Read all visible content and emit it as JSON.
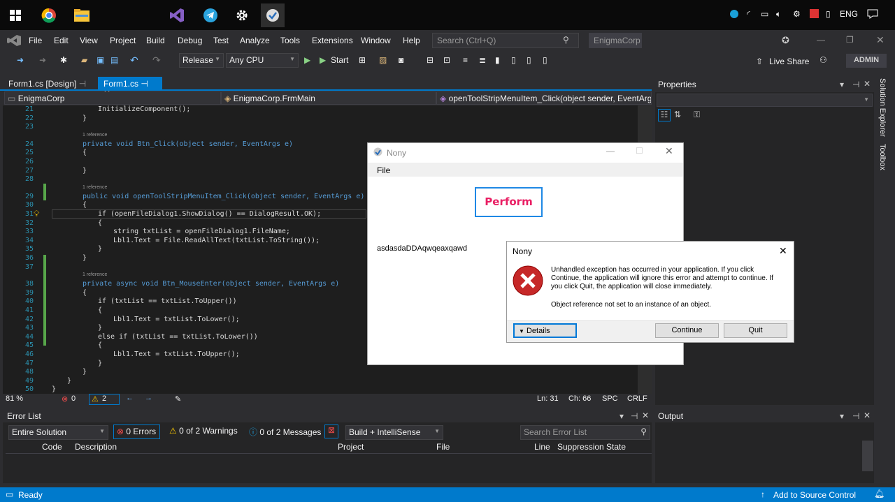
{
  "taskbar": {
    "lang": "ENG"
  },
  "menubar": {
    "items": [
      "File",
      "Edit",
      "View",
      "Project",
      "Build",
      "Debug",
      "Test",
      "Analyze",
      "Tools",
      "Extensions",
      "Window",
      "Help"
    ],
    "search_placeholder": "Search (Ctrl+Q)",
    "solution": "EnigmaCorp"
  },
  "toolbar": {
    "config": "Release",
    "platform": "Any CPU",
    "start": "Start",
    "live_share": "Live Share",
    "admin": "ADMIN"
  },
  "tabs": {
    "designer": "Form1.cs [Design]",
    "code": "Form1.cs"
  },
  "nav": {
    "project": "EnigmaCorp",
    "class": "EnigmaCorp.FrmMain",
    "member": "openToolStripMenuItem_Click(object sender, EventArgs"
  },
  "editor": {
    "lines": [
      {
        "n": "21",
        "t": "InitializeComponent();"
      },
      {
        "n": "22",
        "t": "}"
      },
      {
        "n": "23",
        "t": ""
      },
      {
        "n": "24",
        "t": "private void Btn_Click(object sender, EventArgs e)"
      },
      {
        "n": "25",
        "t": "{"
      },
      {
        "n": "26",
        "t": ""
      },
      {
        "n": "27",
        "t": "}"
      },
      {
        "n": "28",
        "t": ""
      },
      {
        "n": "29",
        "t": "public void openToolStripMenuItem_Click(object sender, EventArgs e)"
      },
      {
        "n": "30",
        "t": "{"
      },
      {
        "n": "31",
        "t": "if (openFileDialog1.ShowDialog() == DialogResult.OK);"
      },
      {
        "n": "32",
        "t": "{"
      },
      {
        "n": "33",
        "t": "string txtList = openFileDialog1.FileName;"
      },
      {
        "n": "34",
        "t": "Lbl1.Text = File.ReadAllText(txtList.ToString());"
      },
      {
        "n": "35",
        "t": "}"
      },
      {
        "n": "36",
        "t": "}"
      },
      {
        "n": "37",
        "t": ""
      },
      {
        "n": "38",
        "t": "private async void Btn_MouseEnter(object sender, EventArgs e)"
      },
      {
        "n": "39",
        "t": "{"
      },
      {
        "n": "40",
        "t": "if (txtList == txtList.ToUpper())"
      },
      {
        "n": "41",
        "t": "{"
      },
      {
        "n": "42",
        "t": "Lbl1.Text = txtList.ToLower();"
      },
      {
        "n": "43",
        "t": "}"
      },
      {
        "n": "44",
        "t": "else if (txtList == txtList.ToLower())"
      },
      {
        "n": "45",
        "t": "{"
      },
      {
        "n": "46",
        "t": "Lbl1.Text = txtList.ToUpper();"
      },
      {
        "n": "47",
        "t": "}"
      },
      {
        "n": "48",
        "t": "}"
      },
      {
        "n": "49",
        "t": "}"
      },
      {
        "n": "50",
        "t": "}"
      }
    ],
    "ref_label": "1 reference"
  },
  "edstatus": {
    "zoom": "81 %",
    "errors": "0",
    "warnings": "2",
    "ln": "Ln: 31",
    "ch": "Ch: 66",
    "spc": "SPC",
    "crlf": "CRLF"
  },
  "props": {
    "title": "Properties"
  },
  "side": {
    "solution_explorer": "Solution Explorer",
    "toolbox": "Toolbox"
  },
  "errlist": {
    "title": "Error List",
    "scope": "Entire Solution",
    "errors": "0 Errors",
    "warnings": "0 of 2 Warnings",
    "messages": "0 of 2 Messages",
    "build": "Build + IntelliSense",
    "search": "Search Error List",
    "cols": [
      "Code",
      "Description",
      "Project",
      "File",
      "Line",
      "Suppression State"
    ]
  },
  "output": {
    "title": "Output"
  },
  "status": {
    "ready": "Ready",
    "source_control": "Add to Source Control"
  },
  "nony": {
    "title": "Nony",
    "menu": "File",
    "button": "Perform",
    "label": "asdasdaDDAqwqeaxqawd"
  },
  "dialog": {
    "title": "Nony",
    "message": "Unhandled exception has occurred in your application. If you click Continue, the application will ignore this error and attempt to continue. If you click Quit, the application will close immediately.",
    "detail": "Object reference not set to an instance of an object.",
    "details_btn": "Details",
    "continue_btn": "Continue",
    "quit_btn": "Quit"
  }
}
